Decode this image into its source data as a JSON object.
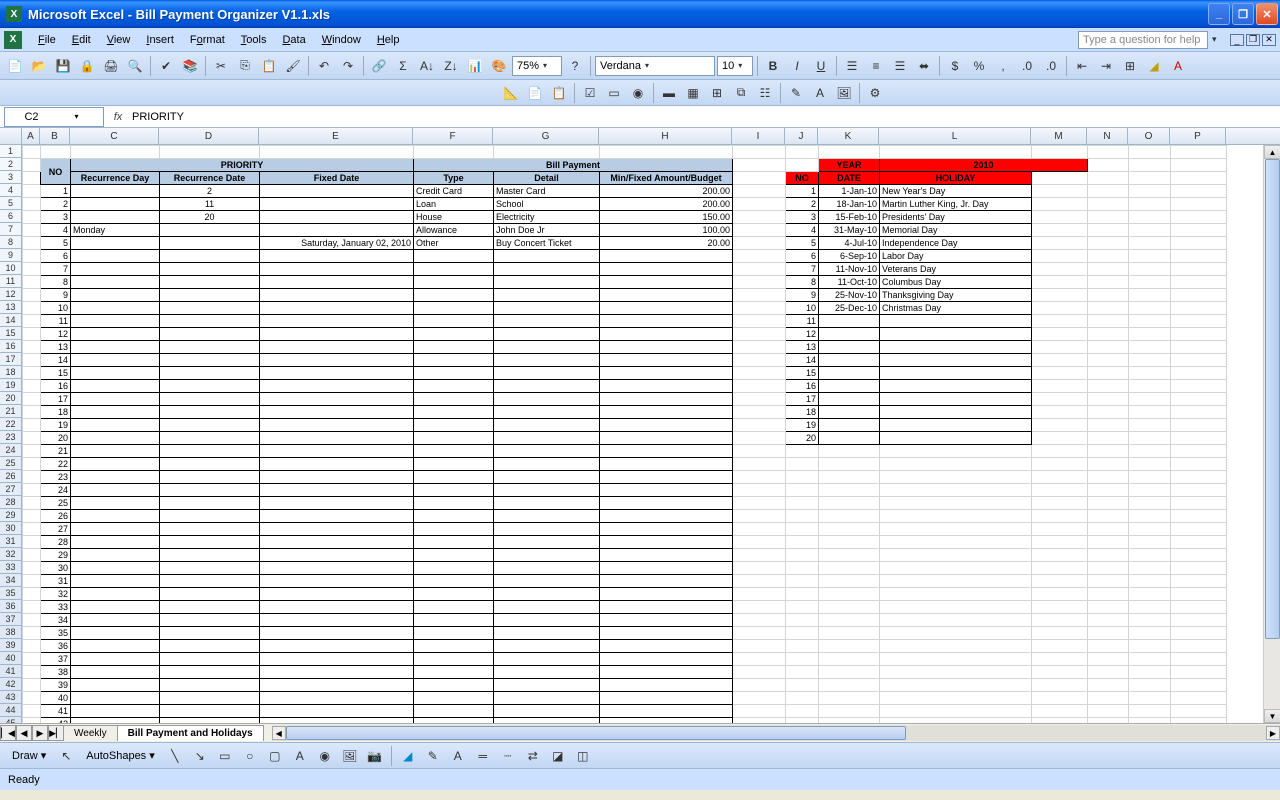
{
  "window": {
    "title": "Microsoft Excel - Bill Payment Organizer V1.1.xls"
  },
  "menu": {
    "file": "File",
    "edit": "Edit",
    "view": "View",
    "insert": "Insert",
    "format": "Format",
    "tools": "Tools",
    "data": "Data",
    "window": "Window",
    "help": "Help",
    "helpbox": "Type a question for help"
  },
  "toolbar": {
    "zoom": "75%",
    "font": "Verdana",
    "size": "10"
  },
  "formula": {
    "cellref": "C2",
    "text": "PRIORITY"
  },
  "columns": [
    "A",
    "B",
    "C",
    "D",
    "E",
    "F",
    "G",
    "H",
    "I",
    "J",
    "K",
    "L",
    "M",
    "N",
    "O",
    "P"
  ],
  "sheet": {
    "priority_header": "PRIORITY",
    "billpayment_header": "Bill Payment",
    "no": "NO",
    "recurrence_day": "Recurrence Day",
    "recurrence_date": "Recurrence Date",
    "fixed_date": "Fixed Date",
    "type": "Type",
    "detail": "Detail",
    "budget": "Min/Fixed Amount/Budget",
    "year": "YEAR",
    "yearval": "2010",
    "hol_no": "NO",
    "hol_date": "DATE",
    "hol_name": "HOLIDAY",
    "rows": [
      {
        "no": "1",
        "rday": "",
        "rdate": "2",
        "fdate": "",
        "type": "Credit Card",
        "detail": "Master Card",
        "amt": "200.00"
      },
      {
        "no": "2",
        "rday": "",
        "rdate": "11",
        "fdate": "",
        "type": "Loan",
        "detail": "School",
        "amt": "200.00"
      },
      {
        "no": "3",
        "rday": "",
        "rdate": "20",
        "fdate": "",
        "type": "House",
        "detail": "Electricity",
        "amt": "150.00"
      },
      {
        "no": "4",
        "rday": "Monday",
        "rdate": "",
        "fdate": "",
        "type": "Allowance",
        "detail": "John Doe Jr",
        "amt": "100.00"
      },
      {
        "no": "5",
        "rday": "",
        "rdate": "",
        "fdate": "Saturday, January 02, 2010",
        "type": "Other",
        "detail": "Buy Concert Ticket",
        "amt": "20.00"
      }
    ],
    "holidays": [
      {
        "no": "1",
        "date": "1-Jan-10",
        "name": "New Year's Day"
      },
      {
        "no": "2",
        "date": "18-Jan-10",
        "name": "Martin Luther King, Jr. Day"
      },
      {
        "no": "3",
        "date": "15-Feb-10",
        "name": "Presidents' Day"
      },
      {
        "no": "4",
        "date": "31-May-10",
        "name": "Memorial Day"
      },
      {
        "no": "5",
        "date": "4-Jul-10",
        "name": "Independence Day"
      },
      {
        "no": "6",
        "date": "6-Sep-10",
        "name": "Labor Day"
      },
      {
        "no": "7",
        "date": "11-Nov-10",
        "name": "Veterans Day"
      },
      {
        "no": "8",
        "date": "11-Oct-10",
        "name": "Columbus Day"
      },
      {
        "no": "9",
        "date": "25-Nov-10",
        "name": "Thanksgiving Day"
      },
      {
        "no": "10",
        "date": "25-Dec-10",
        "name": "Christmas Day"
      }
    ]
  },
  "tabs": {
    "weekly": "Weekly",
    "bills": "Bill Payment and Holidays"
  },
  "drawbar": {
    "draw": "Draw",
    "autoshapes": "AutoShapes"
  },
  "status": {
    "ready": "Ready"
  }
}
